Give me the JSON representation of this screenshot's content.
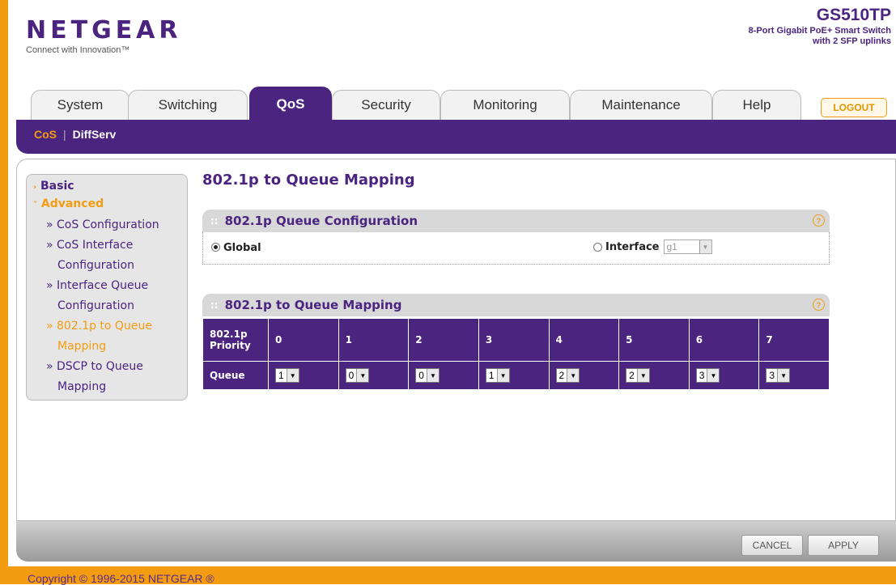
{
  "header": {
    "brand": "NETGEAR",
    "tagline": "Connect with Innovation™",
    "model": "GS510TP",
    "model_desc_line1": "8-Port Gigabit PoE+ Smart Switch",
    "model_desc_line2": "with 2 SFP uplinks",
    "logout": "LOGOUT"
  },
  "tabs": [
    "System",
    "Switching",
    "QoS",
    "Security",
    "Monitoring",
    "Maintenance",
    "Help"
  ],
  "active_tab": "QoS",
  "subnav": {
    "cos": "CoS",
    "sep": "|",
    "diffserv": "DiffServ"
  },
  "sidebar": {
    "basic": "Basic",
    "advanced": "Advanced",
    "items": [
      "» CoS Configuration",
      "» CoS Interface",
      "Configuration",
      "» Interface Queue",
      "Configuration",
      "» 802.1p to Queue",
      "Mapping",
      "» DSCP to Queue",
      "Mapping"
    ]
  },
  "page_title": "802.1p to Queue Mapping",
  "queue_config": {
    "title": "802.1p Queue Configuration",
    "global_label": "Global",
    "interface_label": "Interface",
    "interface_value": "g1",
    "selected": "Global"
  },
  "mapping": {
    "title": "802.1p to Queue Mapping",
    "priority_label_1": "802.1p",
    "priority_label_2": "Priority",
    "queue_label": "Queue",
    "priorities": [
      "0",
      "1",
      "2",
      "3",
      "4",
      "5",
      "6",
      "7"
    ],
    "queues": [
      "1",
      "0",
      "0",
      "1",
      "2",
      "2",
      "3",
      "3"
    ]
  },
  "buttons": {
    "cancel": "CANCEL",
    "apply": "APPLY"
  },
  "copyright": "Copyright © 1996-2015 NETGEAR ®",
  "colors": {
    "brand_purple": "#4b2480",
    "accent_orange": "#f39c12"
  }
}
